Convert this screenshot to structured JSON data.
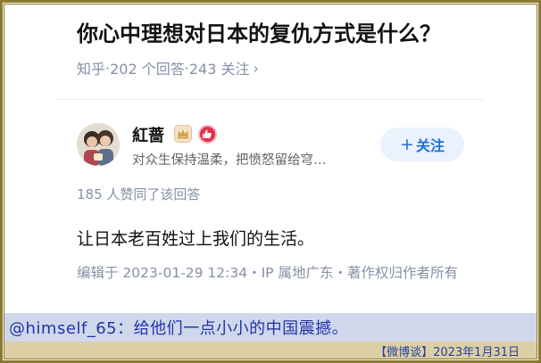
{
  "question": {
    "title": "你心中理想对日本的复仇方式是什么？",
    "platform": "知乎",
    "answers": "202 个回答",
    "followers": "243 关注",
    "separator": " · ",
    "chevron": "›"
  },
  "author": {
    "name": "紅蔷",
    "bio": "对众生保持温柔，把愤怒留给穹…",
    "follow_plus": "+",
    "follow_label": "关注",
    "badges": [
      "crown-badge-icon",
      "thumbs-up-badge-icon"
    ]
  },
  "answer": {
    "upvote_text": "185 人赞同了该回答",
    "content": "让日本老百姓过上我们的生活。",
    "edit_info": "编辑于 2023-01-29 12:34・IP 属地广东・著作权归作者所有"
  },
  "banner": {
    "comment": "@himself_65：给他们一点小小的中国震撼。"
  },
  "footer": {
    "source": "【微博谈】2023年1月31日"
  },
  "colors": {
    "frame": "#8a7a2e",
    "follow_text": "#1f6fe0",
    "follow_bg": "#eaf2fd",
    "banner_bg": "#cfd8ea",
    "banner_text": "#2233aa",
    "footer_bg": "#dccfa5"
  }
}
